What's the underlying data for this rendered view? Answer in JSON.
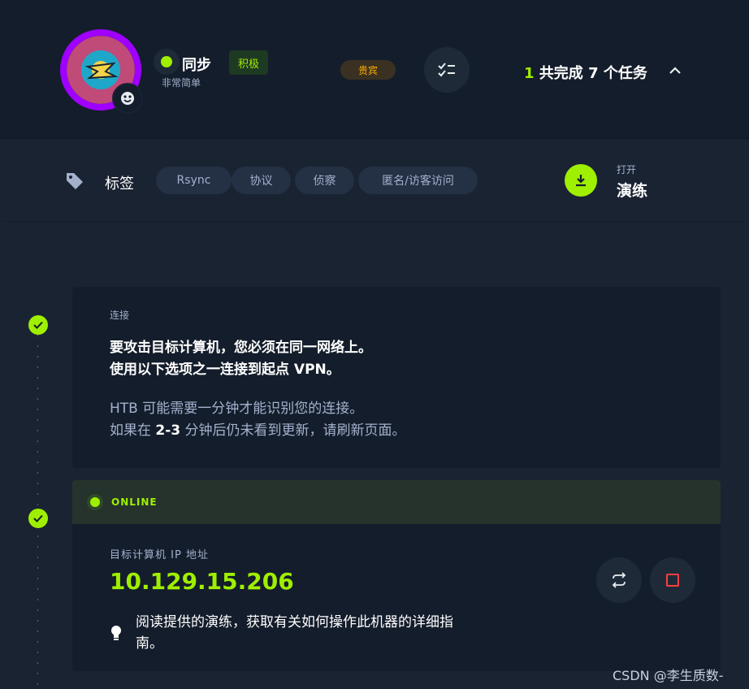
{
  "header": {
    "machine_name": "同步",
    "difficulty": "非常简单",
    "active_badge": "积极",
    "vip_badge": "贵宾",
    "tasks_done": "1",
    "tasks_text": " 共完成 7 个任务"
  },
  "tags": {
    "label": "标签",
    "items": [
      "Rsync",
      "协议",
      "侦察",
      "匿名/访客访问"
    ]
  },
  "walkthrough": {
    "open": "打开",
    "label": "演练"
  },
  "connect_card": {
    "title": "连接",
    "line1": "要攻击目标计算机，您必须在同一网络上。",
    "line2": "使用以下选项之一连接到起点 VPN。",
    "sub1": "HTB 可能需要一分钟才能识别您的连接。",
    "sub2_prefix": "如果在 ",
    "sub2_bold": "2-3",
    "sub2_suffix": " 分钟后仍未看到更新，请刷新页面。"
  },
  "machine_card": {
    "status": "ONLINE",
    "ip_label": "目标计算机 IP 地址",
    "ip": "10.129.15.206",
    "hint": "阅读提供的演练，获取有关如何操作此机器的详细指南。"
  },
  "watermark": "CSDN @李生质数-",
  "colors": {
    "accent": "#9fef00",
    "vip": "#ffaf00",
    "avatar_ring": "#9f00ff",
    "stop": "#ff3e3e"
  },
  "icons": [
    "tag-icon",
    "download-icon",
    "checklist-icon",
    "chevron-up-icon",
    "check-icon",
    "refresh-icon",
    "stop-icon",
    "lightbulb-icon"
  ]
}
